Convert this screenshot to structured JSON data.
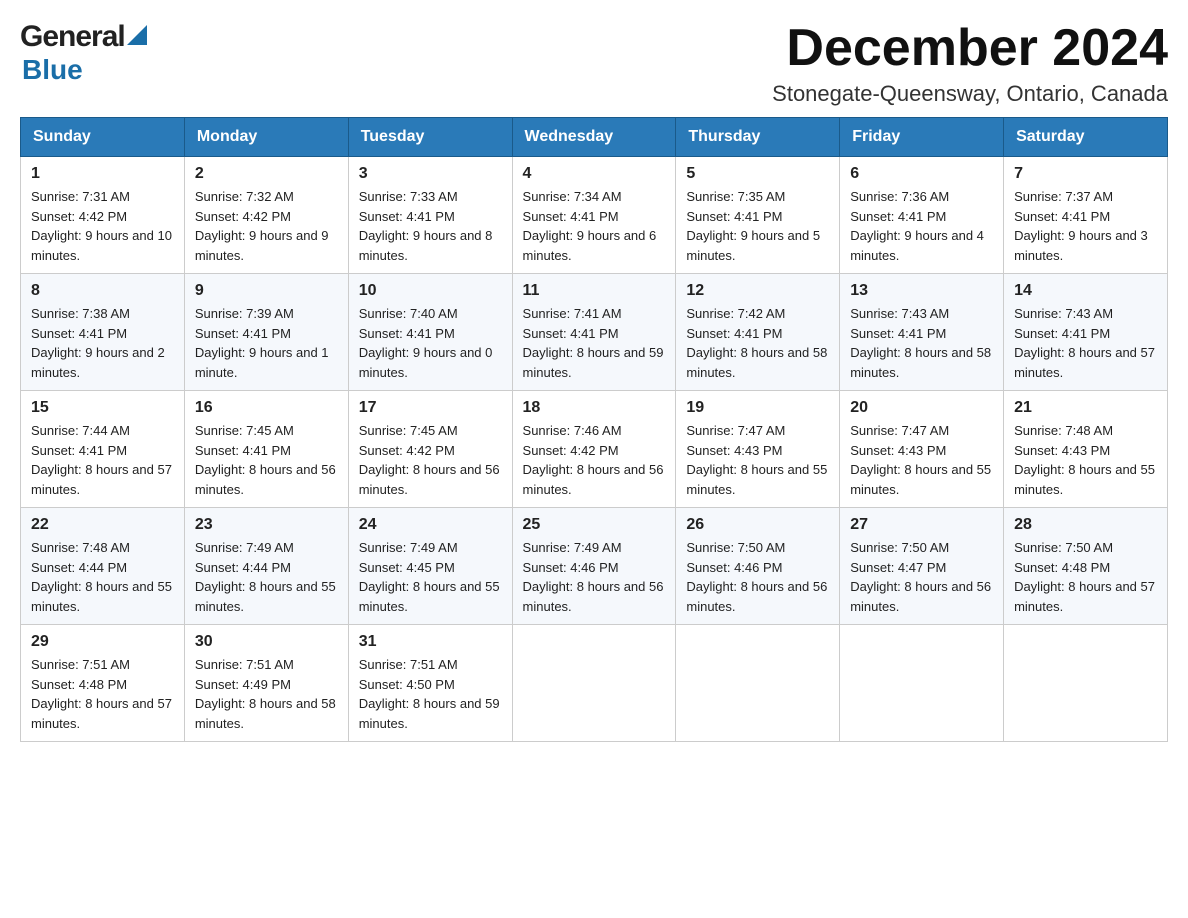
{
  "header": {
    "logo_general": "General",
    "logo_blue": "Blue",
    "month_title": "December 2024",
    "location": "Stonegate-Queensway, Ontario, Canada"
  },
  "days_of_week": [
    "Sunday",
    "Monday",
    "Tuesday",
    "Wednesday",
    "Thursday",
    "Friday",
    "Saturday"
  ],
  "weeks": [
    [
      {
        "date": "1",
        "sunrise": "7:31 AM",
        "sunset": "4:42 PM",
        "daylight": "9 hours and 10 minutes."
      },
      {
        "date": "2",
        "sunrise": "7:32 AM",
        "sunset": "4:42 PM",
        "daylight": "9 hours and 9 minutes."
      },
      {
        "date": "3",
        "sunrise": "7:33 AM",
        "sunset": "4:41 PM",
        "daylight": "9 hours and 8 minutes."
      },
      {
        "date": "4",
        "sunrise": "7:34 AM",
        "sunset": "4:41 PM",
        "daylight": "9 hours and 6 minutes."
      },
      {
        "date": "5",
        "sunrise": "7:35 AM",
        "sunset": "4:41 PM",
        "daylight": "9 hours and 5 minutes."
      },
      {
        "date": "6",
        "sunrise": "7:36 AM",
        "sunset": "4:41 PM",
        "daylight": "9 hours and 4 minutes."
      },
      {
        "date": "7",
        "sunrise": "7:37 AM",
        "sunset": "4:41 PM",
        "daylight": "9 hours and 3 minutes."
      }
    ],
    [
      {
        "date": "8",
        "sunrise": "7:38 AM",
        "sunset": "4:41 PM",
        "daylight": "9 hours and 2 minutes."
      },
      {
        "date": "9",
        "sunrise": "7:39 AM",
        "sunset": "4:41 PM",
        "daylight": "9 hours and 1 minute."
      },
      {
        "date": "10",
        "sunrise": "7:40 AM",
        "sunset": "4:41 PM",
        "daylight": "9 hours and 0 minutes."
      },
      {
        "date": "11",
        "sunrise": "7:41 AM",
        "sunset": "4:41 PM",
        "daylight": "8 hours and 59 minutes."
      },
      {
        "date": "12",
        "sunrise": "7:42 AM",
        "sunset": "4:41 PM",
        "daylight": "8 hours and 58 minutes."
      },
      {
        "date": "13",
        "sunrise": "7:43 AM",
        "sunset": "4:41 PM",
        "daylight": "8 hours and 58 minutes."
      },
      {
        "date": "14",
        "sunrise": "7:43 AM",
        "sunset": "4:41 PM",
        "daylight": "8 hours and 57 minutes."
      }
    ],
    [
      {
        "date": "15",
        "sunrise": "7:44 AM",
        "sunset": "4:41 PM",
        "daylight": "8 hours and 57 minutes."
      },
      {
        "date": "16",
        "sunrise": "7:45 AM",
        "sunset": "4:41 PM",
        "daylight": "8 hours and 56 minutes."
      },
      {
        "date": "17",
        "sunrise": "7:45 AM",
        "sunset": "4:42 PM",
        "daylight": "8 hours and 56 minutes."
      },
      {
        "date": "18",
        "sunrise": "7:46 AM",
        "sunset": "4:42 PM",
        "daylight": "8 hours and 56 minutes."
      },
      {
        "date": "19",
        "sunrise": "7:47 AM",
        "sunset": "4:43 PM",
        "daylight": "8 hours and 55 minutes."
      },
      {
        "date": "20",
        "sunrise": "7:47 AM",
        "sunset": "4:43 PM",
        "daylight": "8 hours and 55 minutes."
      },
      {
        "date": "21",
        "sunrise": "7:48 AM",
        "sunset": "4:43 PM",
        "daylight": "8 hours and 55 minutes."
      }
    ],
    [
      {
        "date": "22",
        "sunrise": "7:48 AM",
        "sunset": "4:44 PM",
        "daylight": "8 hours and 55 minutes."
      },
      {
        "date": "23",
        "sunrise": "7:49 AM",
        "sunset": "4:44 PM",
        "daylight": "8 hours and 55 minutes."
      },
      {
        "date": "24",
        "sunrise": "7:49 AM",
        "sunset": "4:45 PM",
        "daylight": "8 hours and 55 minutes."
      },
      {
        "date": "25",
        "sunrise": "7:49 AM",
        "sunset": "4:46 PM",
        "daylight": "8 hours and 56 minutes."
      },
      {
        "date": "26",
        "sunrise": "7:50 AM",
        "sunset": "4:46 PM",
        "daylight": "8 hours and 56 minutes."
      },
      {
        "date": "27",
        "sunrise": "7:50 AM",
        "sunset": "4:47 PM",
        "daylight": "8 hours and 56 minutes."
      },
      {
        "date": "28",
        "sunrise": "7:50 AM",
        "sunset": "4:48 PM",
        "daylight": "8 hours and 57 minutes."
      }
    ],
    [
      {
        "date": "29",
        "sunrise": "7:51 AM",
        "sunset": "4:48 PM",
        "daylight": "8 hours and 57 minutes."
      },
      {
        "date": "30",
        "sunrise": "7:51 AM",
        "sunset": "4:49 PM",
        "daylight": "8 hours and 58 minutes."
      },
      {
        "date": "31",
        "sunrise": "7:51 AM",
        "sunset": "4:50 PM",
        "daylight": "8 hours and 59 minutes."
      },
      null,
      null,
      null,
      null
    ]
  ]
}
